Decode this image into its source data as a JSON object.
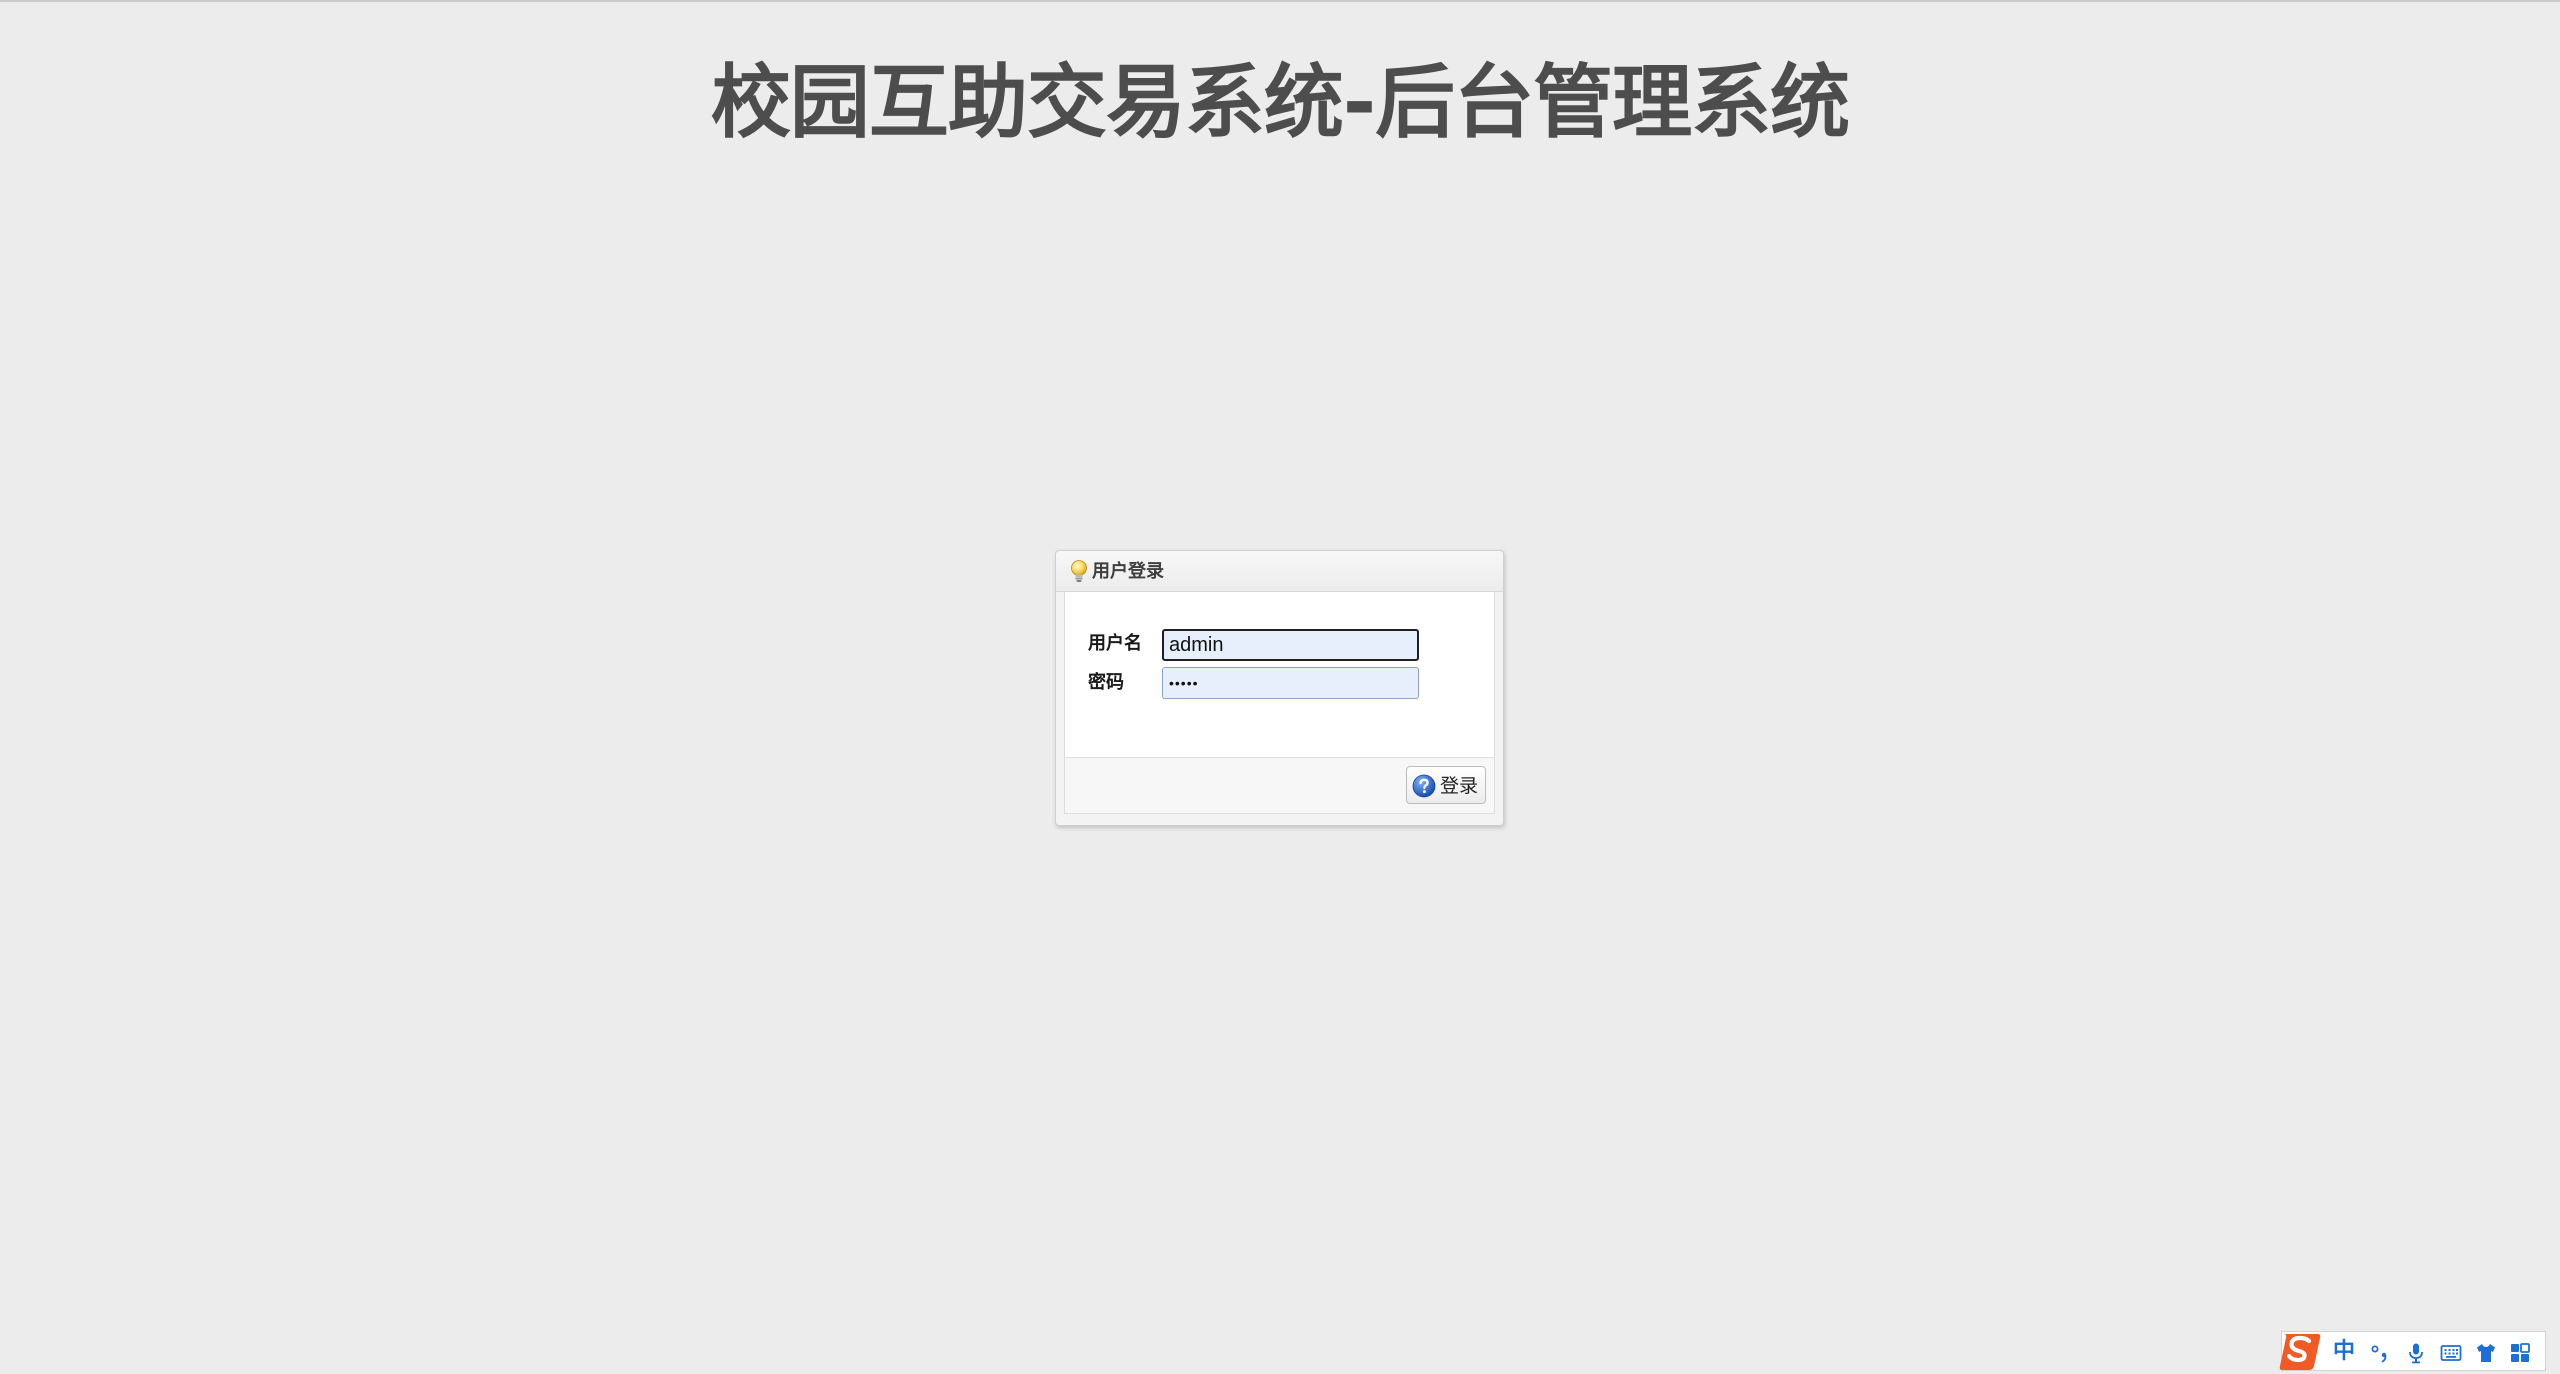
{
  "page": {
    "title": "校园互助交易系统-后台管理系统"
  },
  "login": {
    "panel_title": "用户登录",
    "username_label": "用户名",
    "username_value": "admin",
    "password_label": "密码",
    "password_value": "•••••",
    "submit_label": "登录"
  },
  "ime_toolbar": {
    "mode_label": "中",
    "icons": [
      "sogou-logo-icon",
      "punctuation-icon",
      "microphone-icon",
      "keyboard-icon",
      "skin-shirt-icon",
      "toolbox-grid-icon"
    ]
  },
  "colors": {
    "background": "#ececec",
    "title_text": "#4d4d4d",
    "input_fill": "#e8effc",
    "ime_blue": "#1c6fd6",
    "ime_logo_orange": "#f15a24"
  }
}
